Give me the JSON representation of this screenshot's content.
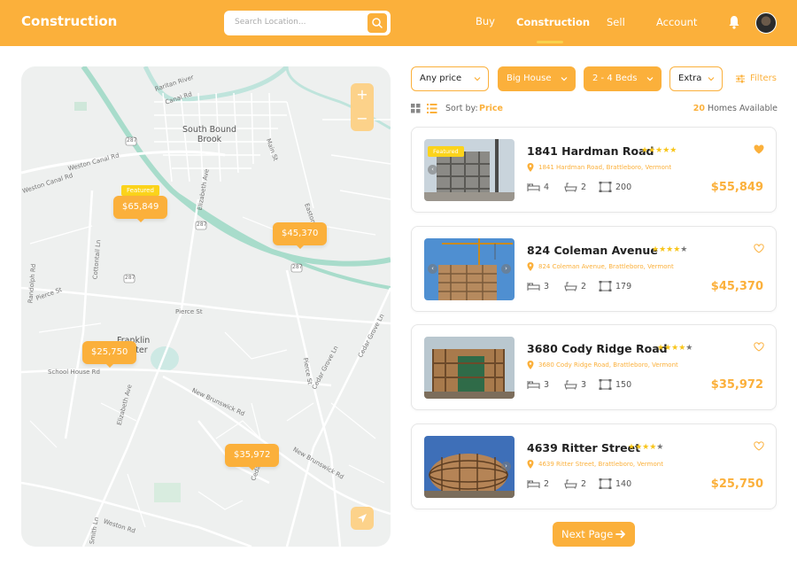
{
  "header": {
    "brand": "Construction",
    "search_placeholder": "Search Location...",
    "nav": [
      "Buy",
      "Construction",
      "Sell",
      "Account"
    ],
    "active_nav": "Construction"
  },
  "colors": {
    "accent": "#fbb03b",
    "badge": "#fbd31b",
    "star": "#f8c51a"
  },
  "map": {
    "labels": {
      "river": "Raritan River",
      "canal_rd": "Canal Rd",
      "south_bound_brook": "South Bound\nBrook",
      "main_st": "Main St",
      "elizabeth_ave": "Elizabeth Ave",
      "weston_canal_rd": "Weston Canal Rd",
      "weston_canal_rd_2": "Weston Canal Rd",
      "easton": "Easton",
      "cottontail_ln": "Cottontail Ln",
      "randolph_rd": "Randolph Rd",
      "pierce_st_1": "Pierce St",
      "pierce_st_2": "Pierce St",
      "franklin_center": "Franklin\nCenter",
      "school_house_rd": "School House Rd",
      "elizabeth_ave_2": "Elizabeth Ave",
      "new_brunswick_rd": "New Brunswick Rd",
      "new_brunswick_rd_2": "New Brunswick Rd",
      "cedar_grove_ln": "Cedar Grove Ln",
      "cedar_grove_ln_2": "Cedar Grove Ln",
      "weston_rd": "Weston Rd",
      "ceda": "Ceda",
      "smith_ln": "Smith Ln",
      "road_287_a": "287",
      "road_287_b": "287",
      "road_287_c": "287",
      "road_287_d": "287",
      "road_527": "527",
      "road_623": "623",
      "road_625": "625"
    },
    "featured_badge": "Featured",
    "pins": [
      "$65,849",
      "$45,370",
      "$25,750",
      "$35,972"
    ]
  },
  "filters": {
    "items": [
      "Any price",
      "Big House",
      "2 - 4 Beds",
      "Extra"
    ],
    "filters_label": "Filters",
    "sort_prefix": "Sort by:",
    "sort_value": "Price",
    "count": "20",
    "count_suffix": "Homes Available"
  },
  "listings": [
    {
      "title": "1841 Hardman Road",
      "rating": 5,
      "address": "1841 Hardman Road, Brattleboro, Vermont",
      "beds": "4",
      "baths": "2",
      "area": "200",
      "price": "$55,849",
      "featured": "Featured",
      "favorite": true
    },
    {
      "title": "824 Coleman Avenue",
      "rating": 4,
      "address": "824 Coleman Avenue, Brattleboro, Vermont",
      "beds": "3",
      "baths": "2",
      "area": "179",
      "price": "$45,370",
      "favorite": false
    },
    {
      "title": "3680 Cody Ridge Road",
      "rating": 4,
      "address": "3680 Cody Ridge Road, Brattleboro, Vermont",
      "beds": "3",
      "baths": "3",
      "area": "150",
      "price": "$35,972",
      "favorite": false
    },
    {
      "title": "4639 Ritter Street",
      "rating": 4,
      "address": "4639 Ritter Street, Brattleboro, Vermont",
      "beds": "2",
      "baths": "2",
      "area": "140",
      "price": "$25,750",
      "favorite": false
    }
  ],
  "pagination": {
    "next_label": "Next Page"
  }
}
